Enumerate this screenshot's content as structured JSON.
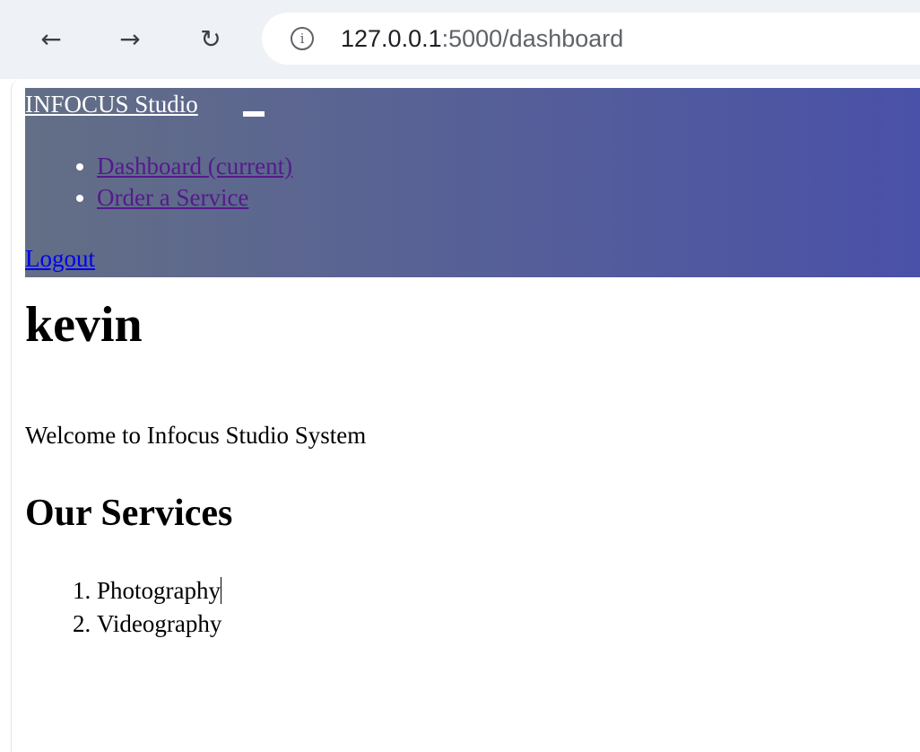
{
  "browser": {
    "back_icon": "←",
    "forward_icon": "→",
    "reload_icon": "↻",
    "info_icon": "i",
    "url_host": "127.0.0.1",
    "url_path": ":5000/dashboard"
  },
  "header": {
    "brand": "INFOCUS Studio",
    "nav_items": [
      {
        "label": "Dashboard (current)"
      },
      {
        "label": "Order a Service"
      }
    ],
    "logout_label": "Logout",
    "gradient_start": "#636f86",
    "gradient_end": "#4a51a8"
  },
  "main": {
    "title": "kevin",
    "welcome": "Welcome to Infocus Studio System",
    "services_heading": "Our Services",
    "services": [
      "Photography",
      "Videography"
    ]
  }
}
